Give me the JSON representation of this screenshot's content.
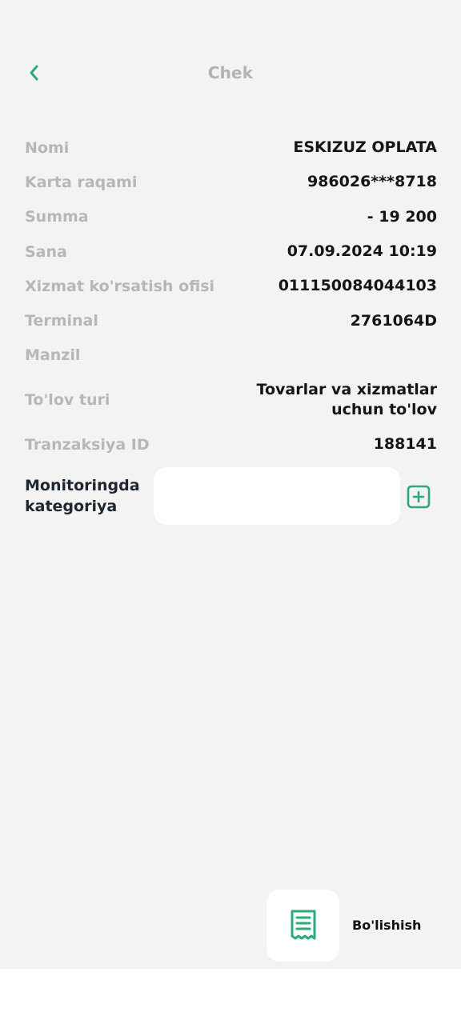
{
  "header": {
    "title": "Chek"
  },
  "details": [
    {
      "label": "Nomi",
      "value": "ESKIZUZ OPLATA"
    },
    {
      "label": "Karta raqami",
      "value": "986026***8718"
    },
    {
      "label": "Summa",
      "value": "- 19 200"
    },
    {
      "label": "Sana",
      "value": "07.09.2024 10:19"
    },
    {
      "label": "Xizmat ko'rsatish ofisi",
      "value": "011150084044103"
    },
    {
      "label": "Terminal",
      "value": "2761064D"
    },
    {
      "label": "Manzil",
      "value": ""
    },
    {
      "label": "To'lov turi",
      "value": "Tovarlar va xizmatlar uchun to'lov"
    },
    {
      "label": "Tranzaksiya ID",
      "value": "188141"
    }
  ],
  "category": {
    "label": "Monitoringda kategoriya",
    "value": ""
  },
  "share": {
    "label": "Bo'lishish"
  },
  "icons": {
    "back": "chevron-left-icon",
    "add": "plus-square-icon",
    "share": "receipt-icon"
  },
  "colors": {
    "accent": "#2eaa7a",
    "background": "#f3f3f3"
  }
}
